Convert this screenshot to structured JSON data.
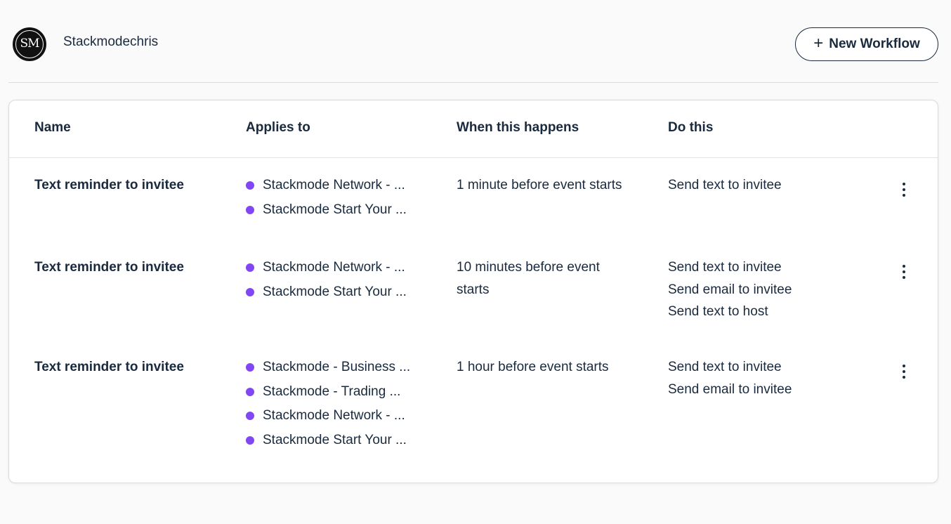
{
  "header": {
    "avatar_initials": "SM",
    "account_name": "Stackmodechris",
    "new_workflow_label": "New Workflow"
  },
  "table": {
    "columns": [
      "Name",
      "Applies to",
      "When this happens",
      "Do this"
    ],
    "rows": [
      {
        "name": "Text reminder to invitee",
        "applies_to": [
          "Stackmode Network - ...",
          "Stackmode Start Your ..."
        ],
        "when": "1 minute before event starts",
        "actions": [
          "Send text to invitee"
        ]
      },
      {
        "name": "Text reminder to invitee",
        "applies_to": [
          "Stackmode Network - ...",
          "Stackmode Start Your ..."
        ],
        "when": "10 minutes before event starts",
        "actions": [
          "Send text to invitee",
          "Send email to invitee",
          "Send text to host"
        ]
      },
      {
        "name": "Text reminder to invitee",
        "applies_to": [
          "Stackmode - Business ...",
          "Stackmode - Trading ...",
          "Stackmode Network - ...",
          "Stackmode Start Your ..."
        ],
        "when": "1 hour before event starts",
        "actions": [
          "Send text to invitee",
          "Send email to invitee"
        ]
      }
    ]
  },
  "colors": {
    "event_dot": "#8247f5",
    "text": "#1a2a3e"
  }
}
